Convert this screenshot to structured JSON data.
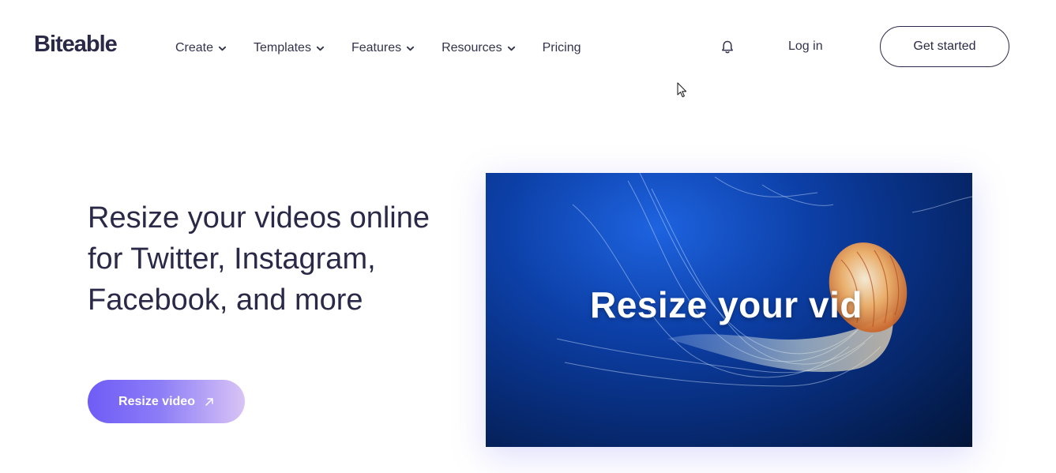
{
  "header": {
    "logo_text": "Biteable",
    "nav": [
      {
        "label": "Create",
        "has_dropdown": true
      },
      {
        "label": "Templates",
        "has_dropdown": true
      },
      {
        "label": "Features",
        "has_dropdown": true
      },
      {
        "label": "Resources",
        "has_dropdown": true
      },
      {
        "label": "Pricing",
        "has_dropdown": false
      }
    ],
    "notification_icon": "bell-icon",
    "login_label": "Log in",
    "cta_label": "Get started"
  },
  "hero": {
    "title": "Resize your videos online for Twitter, Instagram, Facebook, and more",
    "button_label": "Resize video",
    "button_icon": "arrow-up-right-icon"
  },
  "preview": {
    "overlay_text": "Resize your vid"
  },
  "colors": {
    "text_dark": "#2a2a48",
    "cta_gradient_start": "#6f5cf6",
    "cta_gradient_end": "#d9c4f5",
    "video_bg": "#0c3fa6"
  }
}
